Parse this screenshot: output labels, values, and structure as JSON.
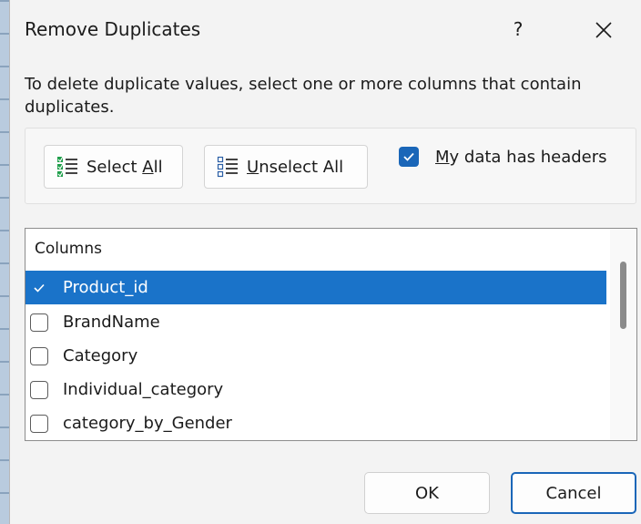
{
  "dialog": {
    "title": "Remove Duplicates",
    "help_label": "?",
    "instructions": "To delete duplicate values, select one or more columns that contain duplicates."
  },
  "toolbar": {
    "select_all_prefix": "Select ",
    "select_all_key": "A",
    "select_all_suffix": "ll",
    "unselect_all_key": "U",
    "unselect_all_suffix": "nselect All",
    "headers_key": "M",
    "headers_suffix": "y data has headers",
    "headers_checked": true
  },
  "columns": {
    "header": "Columns",
    "items": [
      {
        "label": "Product_id",
        "checked": true,
        "selected": true
      },
      {
        "label": "BrandName",
        "checked": false,
        "selected": false
      },
      {
        "label": "Category",
        "checked": false,
        "selected": false
      },
      {
        "label": "Individual_category",
        "checked": false,
        "selected": false
      },
      {
        "label": "category_by_Gender",
        "checked": false,
        "selected": false
      }
    ]
  },
  "footer": {
    "ok_label": "OK",
    "cancel_label": "Cancel"
  },
  "colors": {
    "accent": "#1a66b8",
    "selection": "#1a73c9"
  }
}
